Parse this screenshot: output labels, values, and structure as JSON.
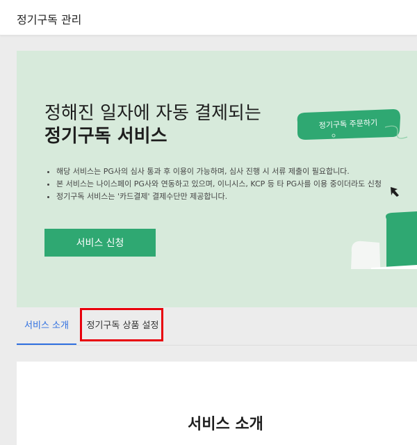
{
  "header": {
    "title": "정기구독 관리"
  },
  "hero": {
    "title_line1": "정해진 일자에 자동 결제되는",
    "title_line2": "정기구독 서비스",
    "bullets": [
      "해당 서비스는 PG사의 심사 통과 후 이용이 가능하며, 심사 진행 시 서류 제출이 필요합니다.",
      "본 서비스는 나이스페이 PG사와 연동하고 있으며, 이니시스, KCP 등 타 PG사를 이용 중이더라도 신청",
      "정기구독 서비스는 '카드결제' 결제수단만 제공합니다."
    ],
    "apply_button": "서비스 신청",
    "illustration_pill": "정기구독 주문하기"
  },
  "tabs": [
    {
      "label": "서비스 소개",
      "active": true
    },
    {
      "label": "정기구독 상품 설정",
      "active": false
    }
  ],
  "section": {
    "title": "서비스 소개"
  },
  "colors": {
    "accent_green": "#2fa872",
    "hero_bg": "#d7eadb",
    "tab_active": "#2e6fe0",
    "highlight": "#e8000b"
  }
}
